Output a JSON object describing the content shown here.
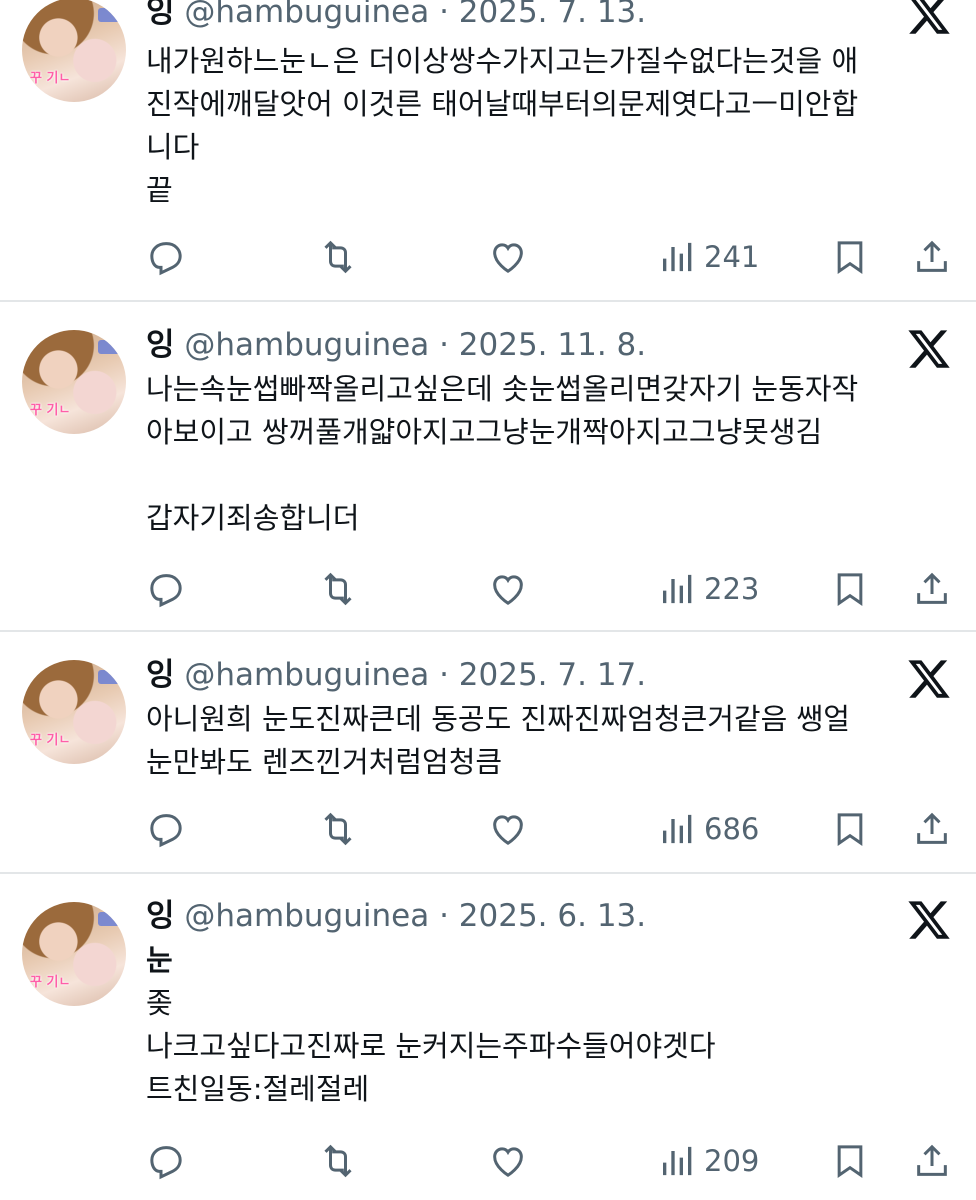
{
  "tweets": [
    {
      "name": "잉",
      "handle": "@hambuguinea",
      "date": "2025. 7. 13.",
      "text": "내가원하느눈ㄴ은 더이상쌍수가지고는가질수없다는것을 애\n진작에깨달앗어 이것른 태어날때부터의문제엿다고ㅡ미안합\n니다\n끝",
      "views": "241"
    },
    {
      "name": "잉",
      "handle": "@hambuguinea",
      "date": "2025. 11. 8.",
      "text": "나는속눈썹빠짝올리고싶은데 솟눈썹올리면갖자기 눈동자작\n아보이고 쌍꺼풀개얇아지고그냥눈개짝아지고그냥못생김\n\n갑자기죄송합니더",
      "views": "223"
    },
    {
      "name": "잉",
      "handle": "@hambuguinea",
      "date": "2025. 7. 17.",
      "text": "아니원희 눈도진짜큰데 동공도 진짜진짜엄청큰거같음 쌩얼\n눈만봐도 렌즈낀거처럼엄청큼",
      "views": "686"
    },
    {
      "name": "잉",
      "handle": "@hambuguinea",
      "date": "2025. 6. 13.",
      "text_bold": "눈",
      "text": "좆\n나크고싶다고진짜로 눈커지는주파수들어야겟다\n트친일동:절레절레",
      "views": "209"
    }
  ],
  "icons": [
    "reply-icon",
    "retweet-icon",
    "like-icon",
    "views-icon",
    "bookmark-icon",
    "share-icon",
    "x-logo-icon"
  ],
  "colors": {
    "text": "#0f1419",
    "muted": "#536471",
    "divider": "#e3e6e8"
  }
}
